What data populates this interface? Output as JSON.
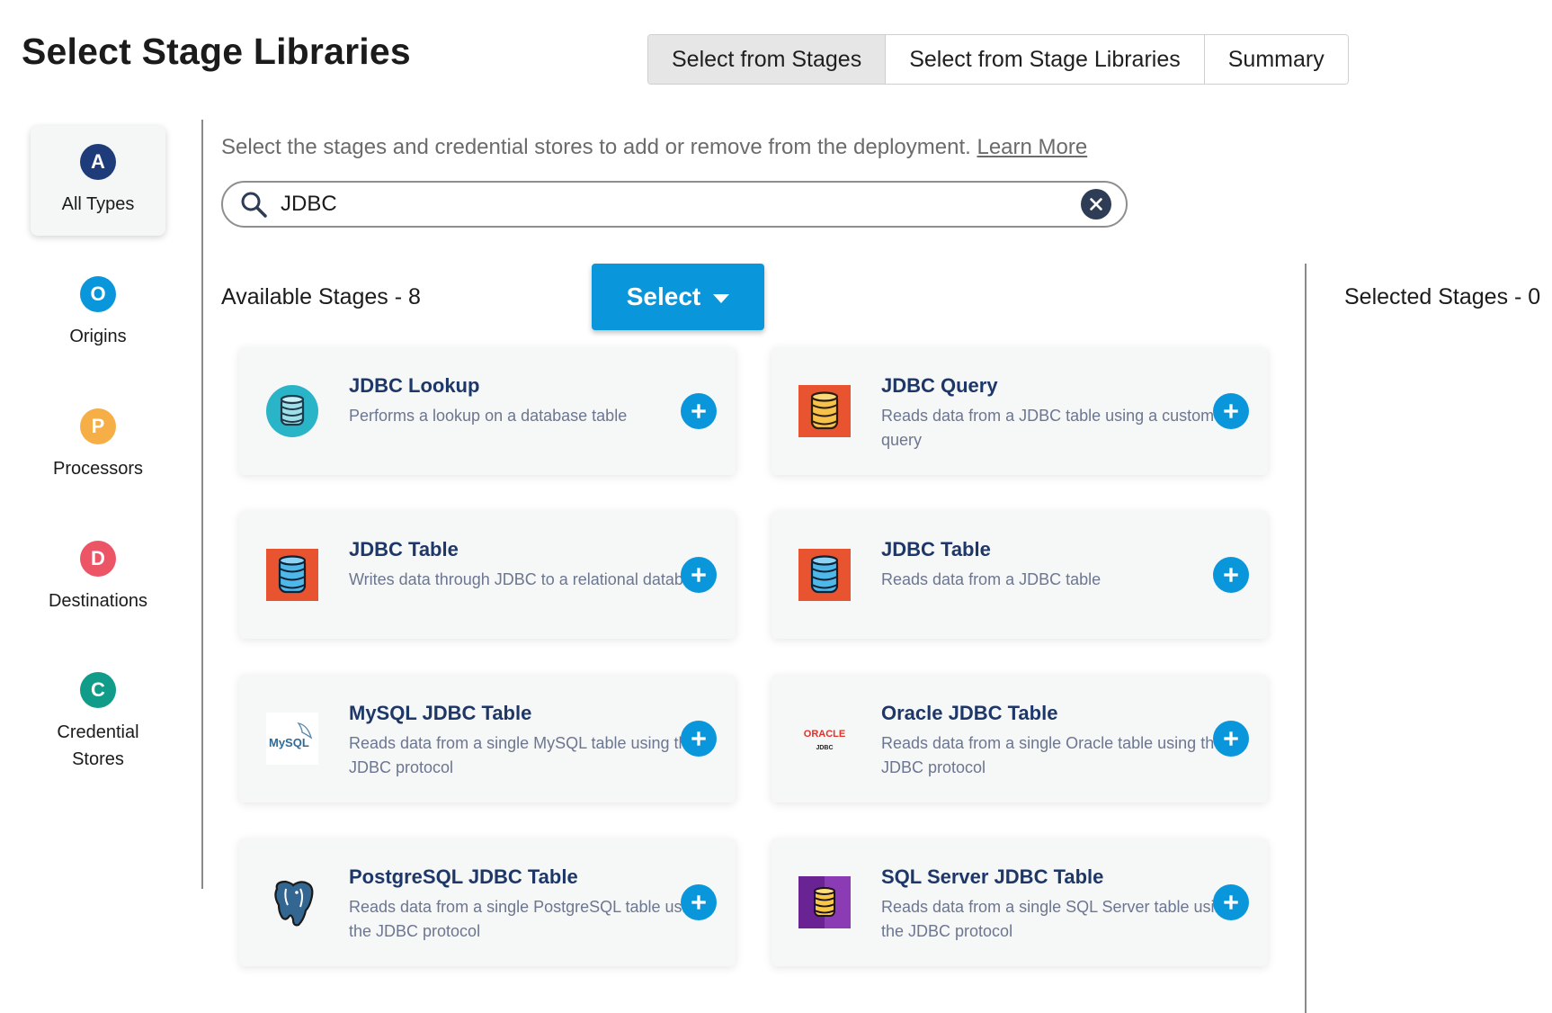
{
  "title": "Select Stage Libraries",
  "tabs": [
    {
      "label": "Select from Stages",
      "active": true
    },
    {
      "label": "Select from Stage Libraries",
      "active": false
    },
    {
      "label": "Summary",
      "active": false
    }
  ],
  "sidebar": {
    "items": [
      {
        "letter": "A",
        "label": "All Types",
        "color": "#1f3c7a",
        "active": true
      },
      {
        "letter": "O",
        "label": "Origins",
        "color": "#0a96db"
      },
      {
        "letter": "P",
        "label": "Processors",
        "color": "#f6ae47"
      },
      {
        "letter": "D",
        "label": "Destinations",
        "color": "#ec5566"
      },
      {
        "letter": "C",
        "label": "Credential Stores",
        "color": "#119c8a"
      }
    ]
  },
  "instruction": {
    "text": "Select the stages and credential stores to add or remove from the deployment.",
    "link": "Learn More"
  },
  "search": {
    "value": "JDBC"
  },
  "available_label": "Available Stages - 8",
  "selected_label": "Selected Stages - 0",
  "select_button": "Select",
  "stages": [
    {
      "title": "JDBC Lookup",
      "desc": "Performs a lookup on a database table",
      "icon": "teal-database-icon"
    },
    {
      "title": "JDBC Query",
      "desc": "Reads data from a JDBC table using a custom query",
      "icon": "orange-database-icon"
    },
    {
      "title": "JDBC Table",
      "desc": "Writes data through JDBC to a relational database",
      "icon": "blue-database-icon"
    },
    {
      "title": "JDBC Table",
      "desc": "Reads data from a JDBC table",
      "icon": "blue-database-icon"
    },
    {
      "title": "MySQL JDBC Table",
      "desc": "Reads data from a single MySQL table using the JDBC protocol",
      "icon": "mysql-logo-icon",
      "logo_text": "MySQL"
    },
    {
      "title": "Oracle JDBC Table",
      "desc": "Reads data from a single Oracle table using the JDBC protocol",
      "icon": "oracle-jdbc-logo-icon",
      "logo_text": "ORACLE",
      "logo_sub": "JDBC"
    },
    {
      "title": "PostgreSQL JDBC Table",
      "desc": "Reads data from a single PostgreSQL table using the JDBC protocol",
      "icon": "postgresql-elephant-icon"
    },
    {
      "title": "SQL Server JDBC Table",
      "desc": "Reads data from a single SQL Server table using the JDBC protocol",
      "icon": "purple-database-icon"
    }
  ]
}
